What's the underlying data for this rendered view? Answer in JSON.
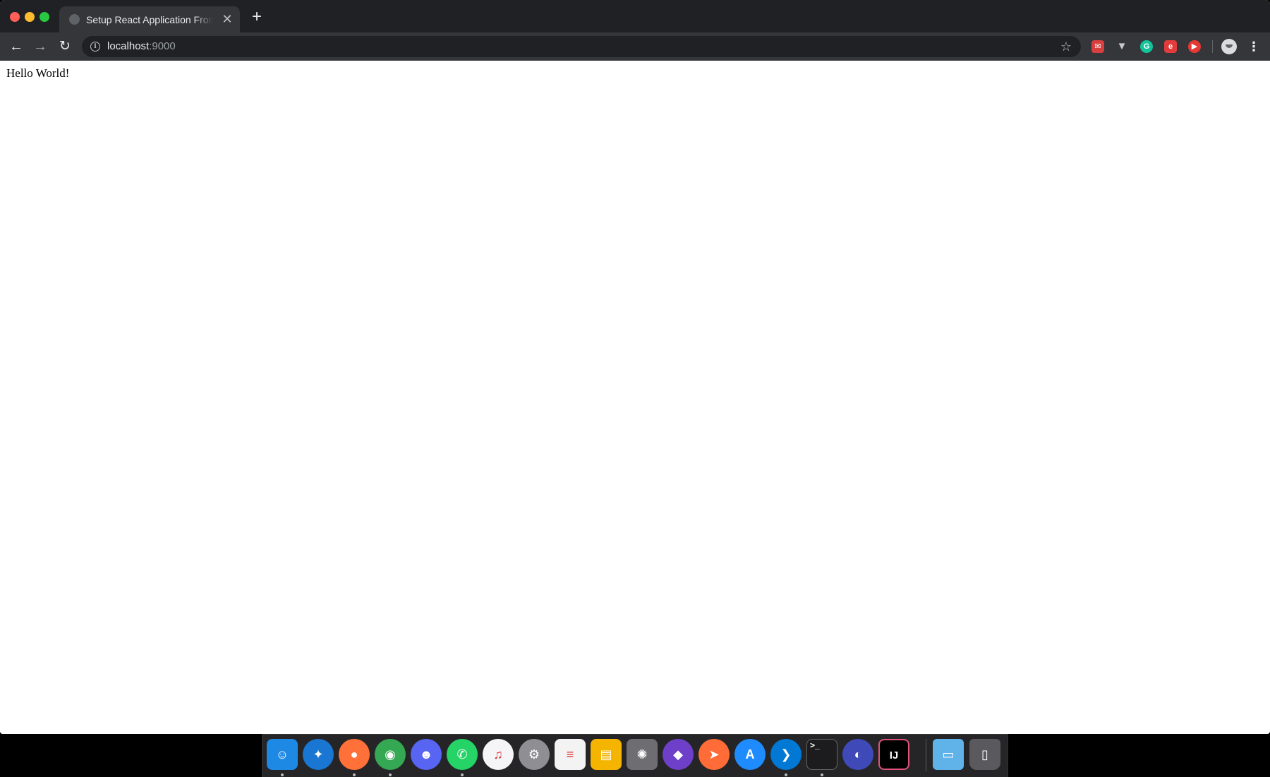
{
  "browser": {
    "tab": {
      "title": "Setup React Application From Scratch",
      "close_glyph": "✕"
    },
    "new_tab_glyph": "+",
    "nav": {
      "back_glyph": "←",
      "forward_glyph": "→",
      "reload_glyph": "↻"
    },
    "address": {
      "host": "localhost",
      "port": ":9000"
    },
    "star_glyph": "☆",
    "menu_glyph": "⋮",
    "extensions": [
      "extension-red-icon",
      "vue-devtools-icon",
      "grammarly-icon",
      "extension-e-icon",
      "youtube-icon"
    ]
  },
  "page": {
    "content_text": "Hello World!"
  },
  "dock": {
    "apps": [
      {
        "name": "finder-icon",
        "glyph": "☺",
        "color": "#1e88e5",
        "running": true
      },
      {
        "name": "safari-icon",
        "glyph": "✦",
        "color": "#1976d2",
        "running": false
      },
      {
        "name": "firefox-icon",
        "glyph": "●",
        "color": "#ff7139",
        "running": true
      },
      {
        "name": "chrome-icon",
        "glyph": "◉",
        "color": "#34a853",
        "running": true
      },
      {
        "name": "discord-icon",
        "glyph": "☻",
        "color": "#5865f2",
        "running": false
      },
      {
        "name": "whatsapp-icon",
        "glyph": "✆",
        "color": "#25d366",
        "running": true
      },
      {
        "name": "itunes-icon",
        "glyph": "♫",
        "color": "#f5f5f7",
        "running": false
      },
      {
        "name": "system-preferences-icon",
        "glyph": "⚙",
        "color": "#8e8e93",
        "running": false
      },
      {
        "name": "textedit-icon",
        "glyph": "≡",
        "color": "#f3f3f3",
        "running": false
      },
      {
        "name": "stickies-icon",
        "glyph": "▤",
        "color": "#f4b400",
        "running": false
      },
      {
        "name": "app-gear-icon",
        "glyph": "✺",
        "color": "#6d6d72",
        "running": false
      },
      {
        "name": "github-desktop-icon",
        "glyph": "◆",
        "color": "#6e40c9",
        "running": false
      },
      {
        "name": "postman-icon",
        "glyph": "➤",
        "color": "#ff6c37",
        "running": false
      },
      {
        "name": "app-store-icon",
        "glyph": "A",
        "color": "#1e8bff",
        "running": false
      },
      {
        "name": "vscode-icon",
        "glyph": "❯",
        "color": "#0078d4",
        "running": true
      },
      {
        "name": "terminal-icon",
        "glyph": ">_",
        "color": "#1c1c1e",
        "running": true
      },
      {
        "name": "night-app-icon",
        "glyph": "◐",
        "color": "#3f4ab8",
        "running": false
      },
      {
        "name": "intellij-icon",
        "glyph": "IJ",
        "color": "#000000",
        "running": false
      }
    ],
    "extras": [
      {
        "name": "downloads-folder-icon",
        "glyph": "▭",
        "color": "#5fb3e8"
      },
      {
        "name": "trash-icon",
        "glyph": "▯",
        "color": "#5a5a5e"
      }
    ]
  }
}
